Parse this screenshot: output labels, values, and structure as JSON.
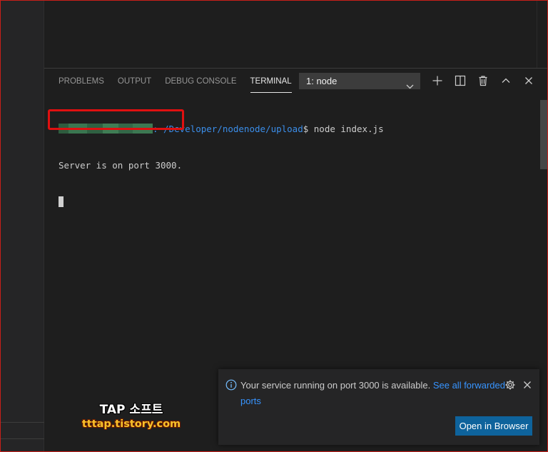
{
  "panel": {
    "tabs": [
      {
        "label": "PROBLEMS"
      },
      {
        "label": "OUTPUT"
      },
      {
        "label": "DEBUG CONSOLE"
      },
      {
        "label": "TERMINAL",
        "active": true
      }
    ],
    "terminal_select": "1: node",
    "actions": [
      "add-icon",
      "split-icon",
      "trash-icon",
      "chevron-up-icon",
      "close-icon"
    ]
  },
  "terminal": {
    "prompt_path": ":~/Developer/nodenode/upload",
    "prompt_symbol": "$",
    "command": " node index.js",
    "output": "Server is on port 3000."
  },
  "notification": {
    "message": "Your service running on port 3000 is available.",
    "link_text": "See all forwarded ports",
    "button_label": "Open in Browser",
    "icons": [
      "info-icon",
      "gear-icon",
      "close-icon"
    ]
  },
  "watermark": {
    "title": "TAP 소프트",
    "site": "tttap.tistory.com"
  },
  "colors": {
    "background": "#1e1e1e",
    "path": "#3b8eea",
    "link": "#3794ff",
    "button": "#0e639c",
    "highlight": "#e01010"
  }
}
